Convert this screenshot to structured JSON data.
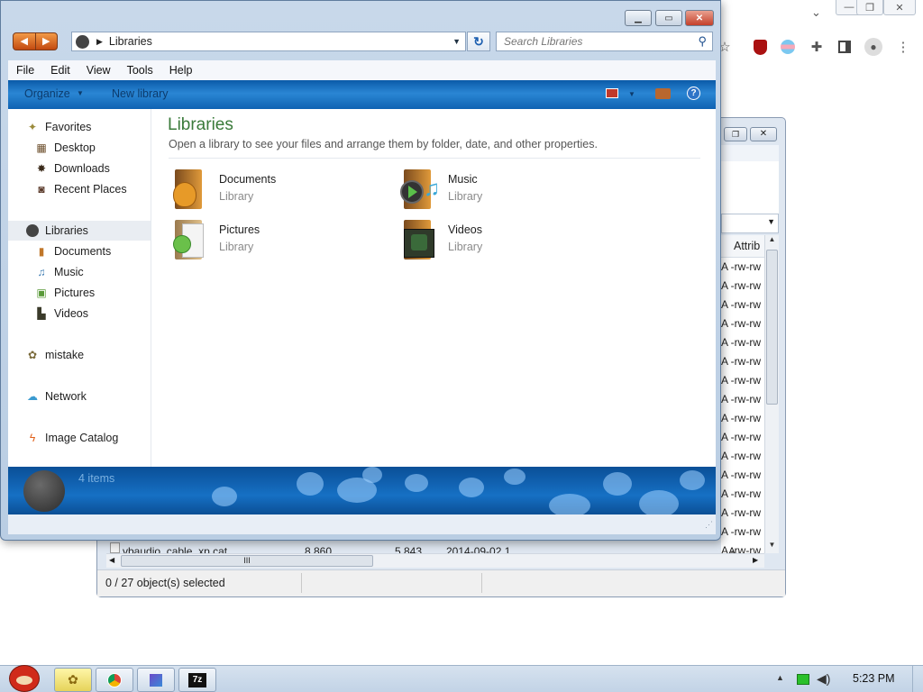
{
  "explorer": {
    "address": "Libraries",
    "search_placeholder": "Search Libraries",
    "menu": [
      "File",
      "Edit",
      "View",
      "Tools",
      "Help"
    ],
    "organize_label": "Organize",
    "new_library_label": "New library",
    "nav": {
      "favorites": "Favorites",
      "desktop": "Desktop",
      "downloads": "Downloads",
      "recent_places": "Recent Places",
      "libraries": "Libraries",
      "documents": "Documents",
      "music": "Music",
      "pictures": "Pictures",
      "videos": "Videos",
      "mistake": "mistake",
      "network": "Network",
      "image_catalog": "Image Catalog"
    },
    "heading": "Libraries",
    "subheading": "Open a library to see your files and arrange them by folder, date, and other properties.",
    "libraries": [
      {
        "name": "Documents",
        "type": "Library"
      },
      {
        "name": "Music",
        "type": "Library"
      },
      {
        "name": "Pictures",
        "type": "Library"
      },
      {
        "name": "Videos",
        "type": "Library"
      }
    ],
    "items_count": "4 items"
  },
  "zip": {
    "attrib_header": "Attrib",
    "attr_values": [
      "A -rw-rw",
      "A -rw-rw",
      "A -rw-rw",
      "A -rw-rw",
      "A -rw-rw",
      "A -rw-rw",
      "A -rw-rw",
      "A -rw-rw",
      "A -rw-rw",
      "A -rw-rw",
      "A -rw-rw",
      "A -rw-rw",
      "A -rw-rw",
      "A -rw-rw",
      "A -rw-rw",
      "A -rw-rw"
    ],
    "partial_row": {
      "name": "vbaudio_cable_xp.cat",
      "size": "8 860",
      "packed": "5 843",
      "date": "2014-09-02 1",
      "attr": "A -rw-rw"
    },
    "status": "0 / 27 object(s) selected"
  },
  "taskbar": {
    "clock": "5:23 PM",
    "zip_label": "7z"
  },
  "colors": {
    "accent_blue": "#1670c4",
    "heading_green": "#3a7a3a"
  }
}
